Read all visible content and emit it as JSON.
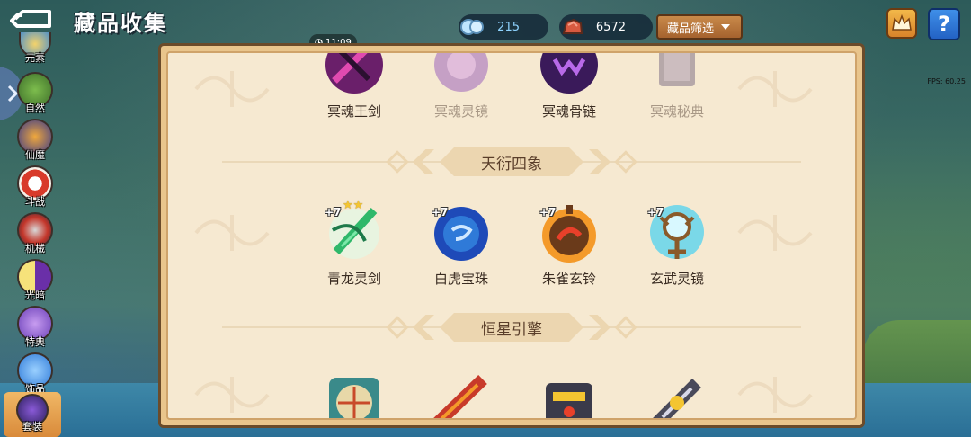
{
  "header": {
    "title": "藏品收集",
    "gems_value": "215",
    "ore_value": "6572",
    "filter_label": "藏品筛选",
    "help_label": "?",
    "time": "11:09",
    "fps": "FPS: 60.25"
  },
  "sidebar": {
    "items": [
      {
        "label": "元素",
        "icon": "element-icon"
      },
      {
        "label": "自然",
        "icon": "tree-icon"
      },
      {
        "label": "仙魔",
        "icon": "demon-icon"
      },
      {
        "label": "斗战",
        "icon": "battle-icon"
      },
      {
        "label": "机械",
        "icon": "mech-icon"
      },
      {
        "label": "光暗",
        "icon": "light-dark-icon"
      },
      {
        "label": "特典",
        "icon": "special-icon"
      },
      {
        "label": "饰品",
        "icon": "puzzle-icon"
      },
      {
        "label": "套装",
        "icon": "set-icon"
      }
    ]
  },
  "row_top": [
    {
      "name": "冥魂王剑",
      "collected": true
    },
    {
      "name": "冥魂灵镜",
      "collected": false
    },
    {
      "name": "冥魂骨链",
      "collected": true
    },
    {
      "name": "冥魂秘典",
      "collected": false
    }
  ],
  "section1": {
    "title": "天衍四象",
    "items": [
      {
        "name": "青龙灵剑",
        "level": "+7",
        "stars": "★★"
      },
      {
        "name": "白虎宝珠",
        "level": "+7"
      },
      {
        "name": "朱雀玄铃",
        "level": "+7"
      },
      {
        "name": "玄武灵镜",
        "level": "+7"
      }
    ]
  },
  "section2": {
    "title": "恒星引擎"
  },
  "colors": {
    "panel_bg": "#f6e9d1",
    "panel_border": "#6b4b2a",
    "filter_button": "#b8733a",
    "help_button": "#2f7ad8"
  }
}
